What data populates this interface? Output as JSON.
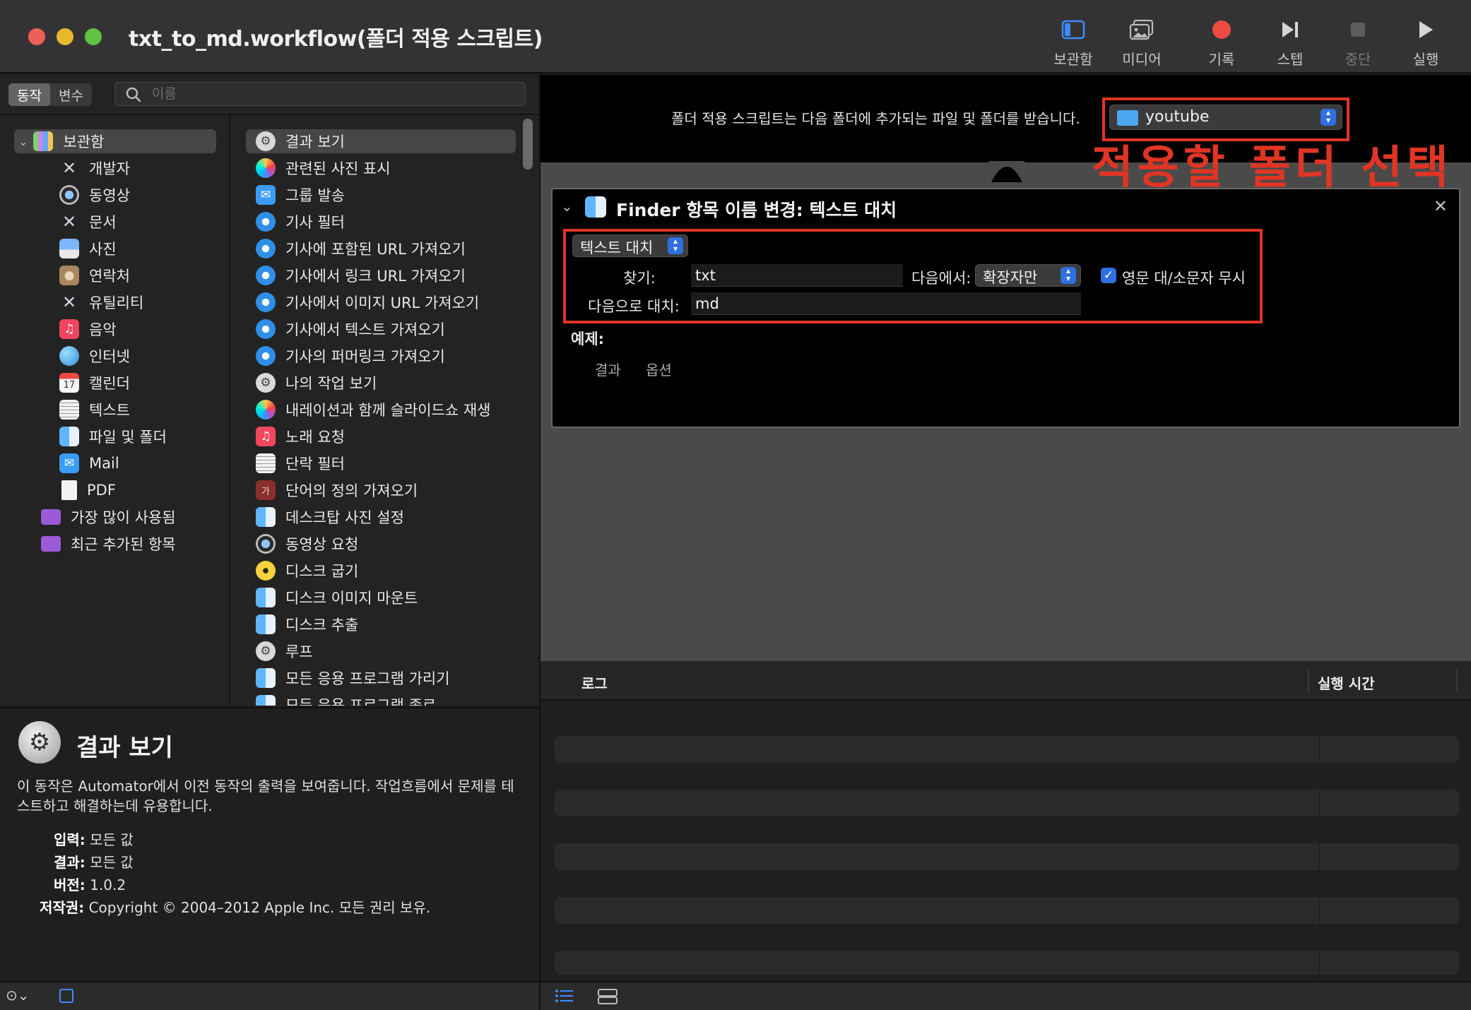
{
  "window": {
    "title": "txt_to_md.workflow(폴더 적용 스크립트)",
    "toolbar": [
      {
        "label": "보관함",
        "icon": "library-panel-icon"
      },
      {
        "label": "미디어",
        "icon": "media-icon"
      },
      {
        "label": "기록",
        "icon": "record-icon"
      },
      {
        "label": "스텝",
        "icon": "step-icon"
      },
      {
        "label": "중단",
        "icon": "stop-icon"
      },
      {
        "label": "실행",
        "icon": "run-icon"
      }
    ]
  },
  "library": {
    "tabs": [
      "동작",
      "변수"
    ],
    "active_tab": "동작",
    "search_placeholder": "이름",
    "categories": [
      {
        "label": "보관함",
        "icon": "library-icon"
      },
      {
        "label": "개발자",
        "icon": "developer-tools-icon"
      },
      {
        "label": "동영상",
        "icon": "quicktime-icon"
      },
      {
        "label": "문서",
        "icon": "tools-icon"
      },
      {
        "label": "사진",
        "icon": "photo-icon"
      },
      {
        "label": "연락처",
        "icon": "contacts-icon"
      },
      {
        "label": "유틸리티",
        "icon": "tools-icon"
      },
      {
        "label": "음악",
        "icon": "music-icon"
      },
      {
        "label": "인터넷",
        "icon": "globe-icon"
      },
      {
        "label": "캘린더",
        "icon": "calendar-icon"
      },
      {
        "label": "텍스트",
        "icon": "text-icon"
      },
      {
        "label": "파일 및 폴더",
        "icon": "finder-icon"
      },
      {
        "label": "Mail",
        "icon": "mail-icon"
      },
      {
        "label": "PDF",
        "icon": "pdf-icon"
      },
      {
        "label": "가장 많이 사용됨",
        "icon": "smart-folder-icon"
      },
      {
        "label": "최근 추가된 항목",
        "icon": "smart-folder-icon"
      }
    ],
    "actions": [
      {
        "label": "결과 보기",
        "icon": "automator-icon"
      },
      {
        "label": "관련된 사진 표시",
        "icon": "photos-icon"
      },
      {
        "label": "그룹 발송",
        "icon": "mail-icon"
      },
      {
        "label": "기사 필터",
        "icon": "safari-icon"
      },
      {
        "label": "기사에 포함된 URL 가져오기",
        "icon": "safari-icon"
      },
      {
        "label": "기사에서 링크 URL 가져오기",
        "icon": "safari-icon"
      },
      {
        "label": "기사에서 이미지 URL 가져오기",
        "icon": "safari-icon"
      },
      {
        "label": "기사에서 텍스트 가져오기",
        "icon": "safari-icon"
      },
      {
        "label": "기사의 퍼머링크 가져오기",
        "icon": "safari-icon"
      },
      {
        "label": "나의 작업 보기",
        "icon": "automator-icon"
      },
      {
        "label": "내레이션과 함께 슬라이드쇼 재생",
        "icon": "photos-icon"
      },
      {
        "label": "노래 요청",
        "icon": "music-icon"
      },
      {
        "label": "단락 필터",
        "icon": "text-icon"
      },
      {
        "label": "단어의 정의 가져오기",
        "icon": "dictionary-icon"
      },
      {
        "label": "데스크탑 사진 설정",
        "icon": "finder-icon"
      },
      {
        "label": "동영상 요청",
        "icon": "quicktime-icon"
      },
      {
        "label": "디스크 굽기",
        "icon": "burn-icon"
      },
      {
        "label": "디스크 이미지 마운트",
        "icon": "finder-icon"
      },
      {
        "label": "디스크 추출",
        "icon": "finder-icon"
      },
      {
        "label": "루프",
        "icon": "automator-icon"
      },
      {
        "label": "모든 응용 프로그램 가리기",
        "icon": "finder-icon"
      },
      {
        "label": "모든 응용 프로그램 종료",
        "icon": "finder-icon"
      }
    ]
  },
  "description": {
    "title": "결과 보기",
    "text": "이 동작은 Automator에서 이전 동작의 출력을 보여줍니다. 작업흐름에서 문제를 테스트하고 해결하는데 유용합니다.",
    "input_label": "입력:",
    "input_value": "모든 값",
    "result_label": "결과:",
    "result_value": "모든 값",
    "version_label": "버전:",
    "version_value": "1.0.2",
    "copyright_label": "저작권:",
    "copyright_value": "Copyright © 2004–2012 Apple Inc.  모든 권리 보유."
  },
  "workflow": {
    "header_text": "폴더 적용 스크립트는 다음 폴더에 추가되는 파일 및 폴더를 받습니다.",
    "folder": "youtube",
    "annotation": "적용할 폴더 선택",
    "action": {
      "title": "Finder 항목 이름 변경: 텍스트 대치",
      "mode": "텍스트 대치",
      "find_label": "찾기:",
      "find_value": "txt",
      "in_label": "다음에서:",
      "in_value": "확장자만",
      "ignore_case_label": "영문 대/소문자 무시",
      "ignore_case_checked": true,
      "replace_label": "다음으로 대치:",
      "replace_value": "md",
      "example_label": "예제:",
      "tabs": [
        "결과",
        "옵션"
      ]
    }
  },
  "log": {
    "col_log": "로그",
    "col_time": "실행 시간"
  },
  "colors": {
    "annotation_red": "#e03524",
    "accent_blue": "#2f6fe0"
  }
}
